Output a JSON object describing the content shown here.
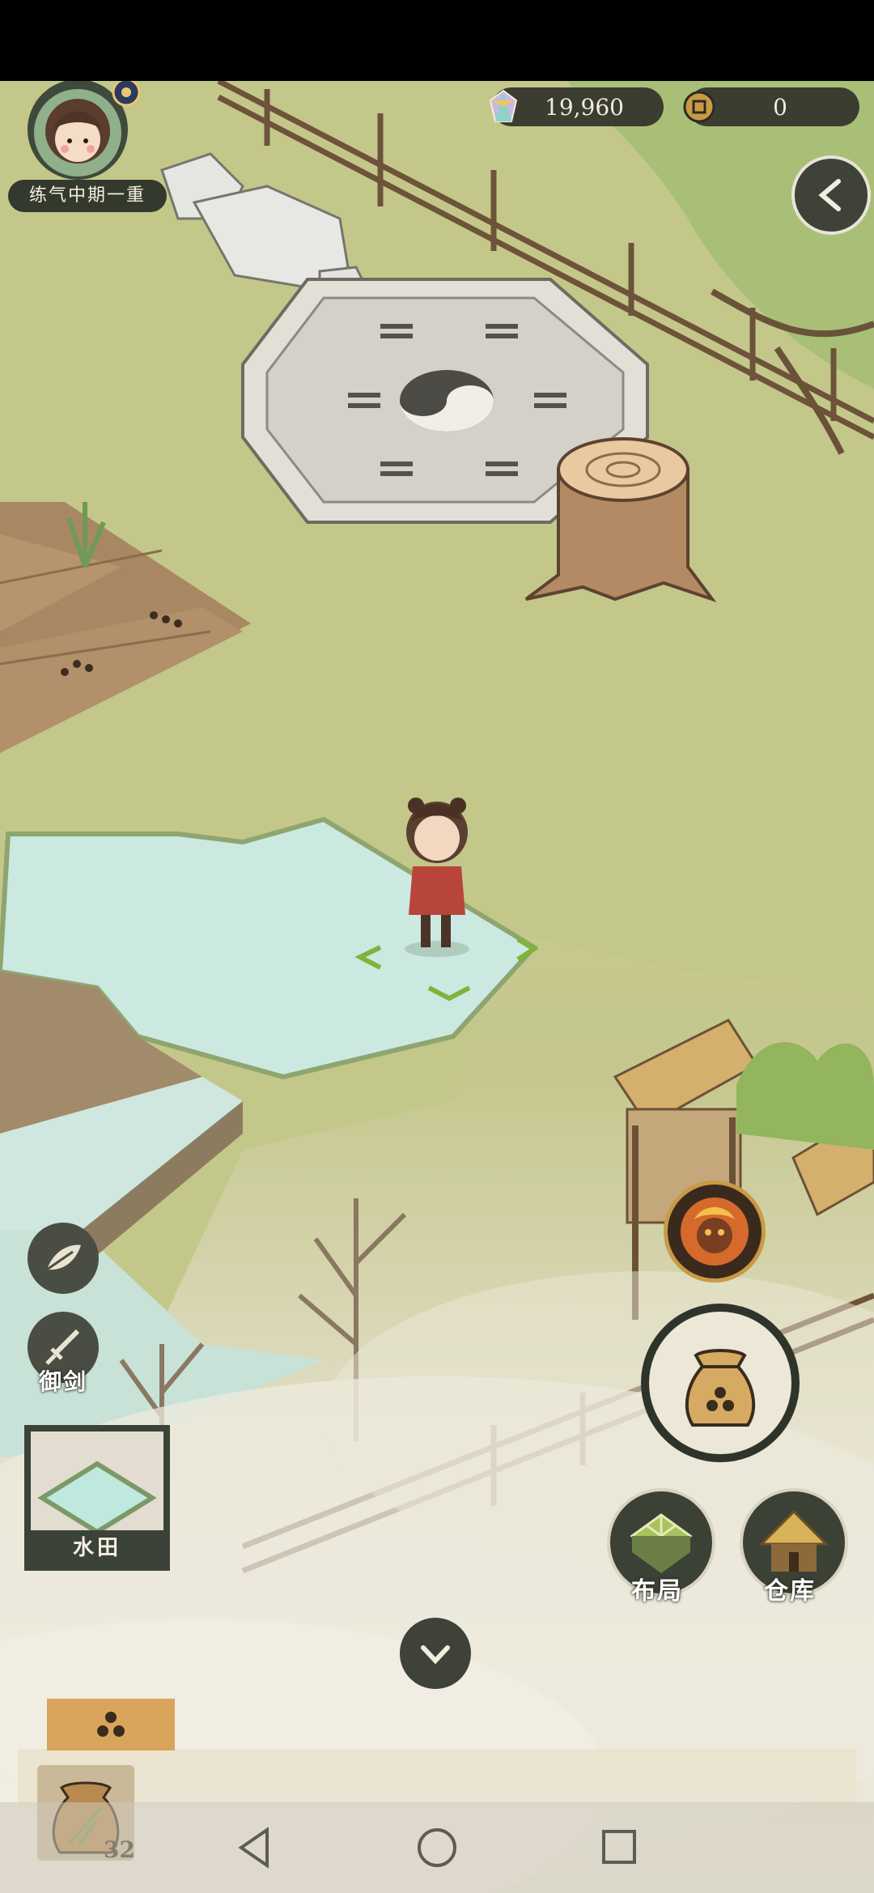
{
  "hud": {
    "spirit_stones": "19,960",
    "coins": "0",
    "realm": "练气中期一重"
  },
  "actions": {
    "sword_label": "御剑",
    "layout_label": "布局",
    "storage_label": "仓库",
    "selected_tile_label": "水田"
  },
  "inventory": {
    "seed_count": "32"
  },
  "icons": [
    "back-arrow-icon",
    "leaf-icon",
    "sword-icon",
    "warrior-icon",
    "seed-bag-icon",
    "layout-icon",
    "storage-hut-icon",
    "collapse-chevron-icon",
    "crystal-icon",
    "coin-icon",
    "nav-back-icon",
    "nav-home-icon",
    "nav-recents-icon"
  ]
}
